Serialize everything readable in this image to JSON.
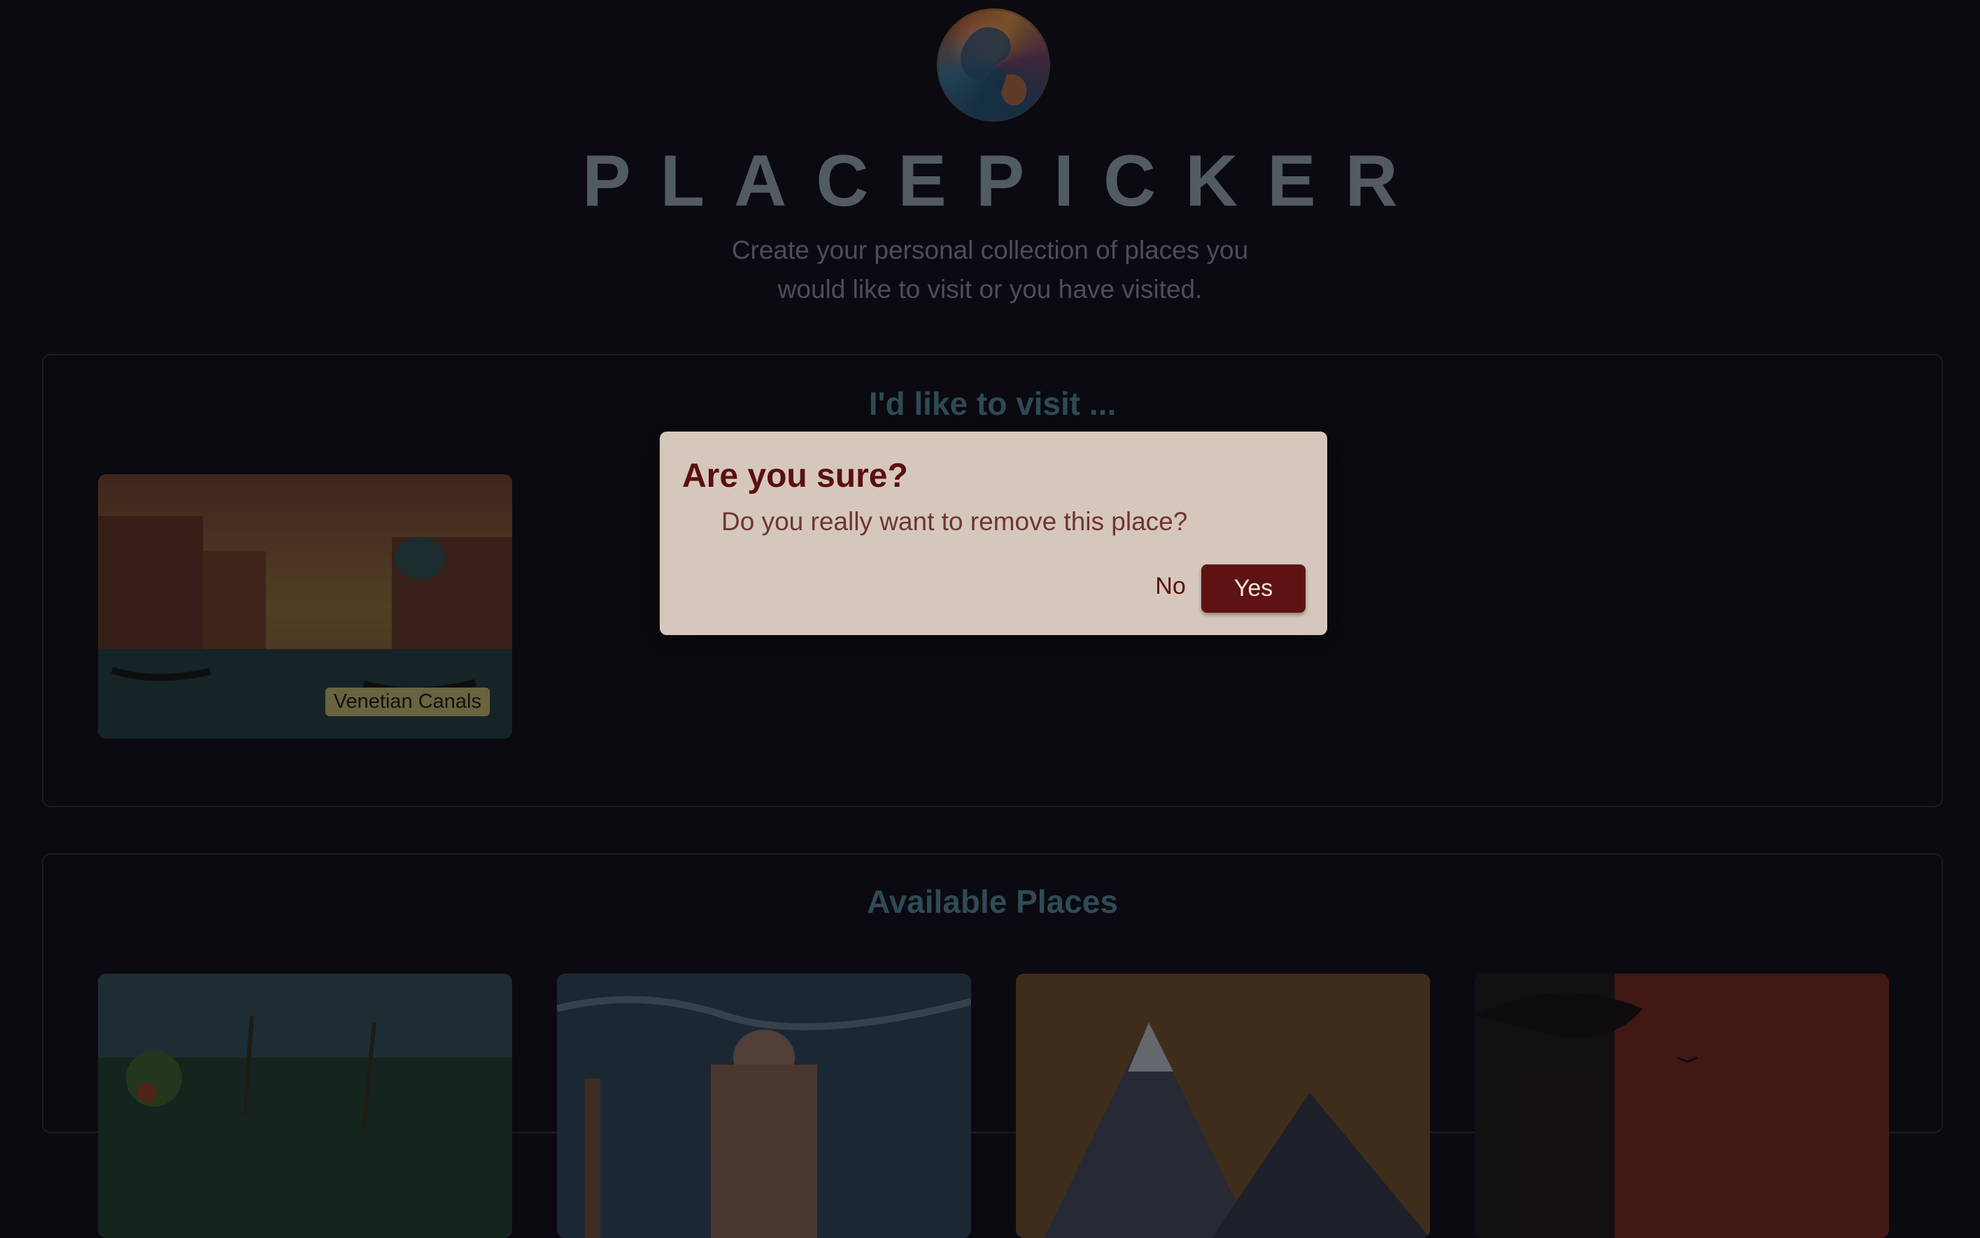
{
  "header": {
    "logo": "globe-logo-icon",
    "title": "PLACEPICKER",
    "subtitle_line1": "Create your personal collection of places you",
    "subtitle_line2": "would like to visit or you have visited."
  },
  "picked": {
    "heading": "I'd like to visit ...",
    "places": [
      {
        "label": "Venetian Canals"
      }
    ]
  },
  "available": {
    "heading": "Available Places"
  },
  "modal": {
    "title": "Are you sure?",
    "text": "Do you really want to remove this place?",
    "no_label": "No",
    "yes_label": "Yes"
  },
  "colors": {
    "background": "#0b0a10",
    "modal_bg": "#d6c7bd",
    "accent": "#5f1212",
    "heading": "#2e4b56"
  }
}
